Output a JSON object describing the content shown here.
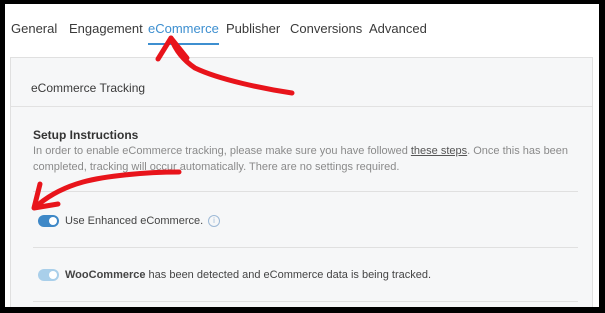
{
  "tabs": [
    {
      "label": "General"
    },
    {
      "label": "Engagement"
    },
    {
      "label": "eCommerce",
      "active": true
    },
    {
      "label": "Publisher"
    },
    {
      "label": "Conversions"
    },
    {
      "label": "Advanced"
    }
  ],
  "panel": {
    "title": "eCommerce Tracking",
    "setup_heading": "Setup Instructions",
    "setup_text_before": "In order to enable eCommerce tracking, please make sure you have followed ",
    "setup_link": "these steps",
    "setup_text_after": ". Once this has been completed, tracking will occur automatically. There are no settings required.",
    "enhanced_label": "Use Enhanced eCommerce.",
    "enhanced_toggle_on": true,
    "woocommerce_name": "WooCommerce",
    "woocommerce_text": " has been detected and eCommerce data is being tracked.",
    "woocommerce_toggle_on": true
  },
  "colors": {
    "accent": "#3d8fd0",
    "annotation_red": "#e8141b"
  },
  "icons": {
    "info": "info-icon"
  }
}
